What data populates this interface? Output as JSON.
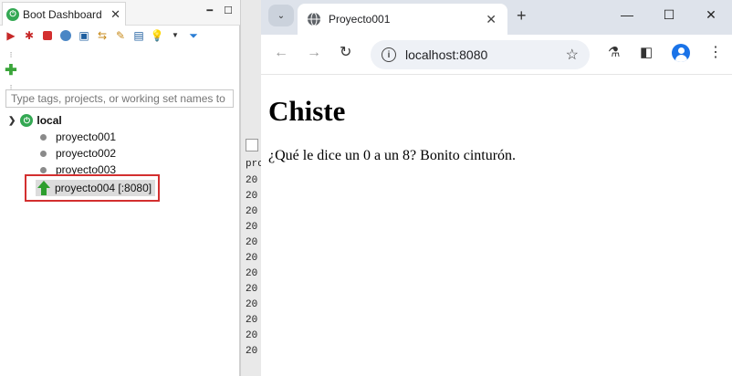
{
  "eclipse": {
    "view_title": "Boot Dashboard",
    "filter_placeholder": "Type tags, projects, or working set names to m",
    "tree": {
      "root_label": "local",
      "items": [
        {
          "label": "proyecto001"
        },
        {
          "label": "proyecto002"
        },
        {
          "label": "proyecto003"
        },
        {
          "label": "proyecto004 [:8080]"
        }
      ]
    },
    "gutter": {
      "header": "pro",
      "rows": [
        "20",
        "20",
        "20",
        "20",
        "20",
        "20",
        "20",
        "20",
        "20",
        "20",
        "20",
        "20"
      ]
    }
  },
  "browser": {
    "tab_title": "Proyecto001",
    "url": "localhost:8080",
    "page": {
      "heading": "Chiste",
      "text": "¿Qué le dice un 0 a un 8? Bonito cinturón."
    }
  },
  "colors": {
    "spring_green": "#34a853",
    "highlight_red": "#d32f2f",
    "chrome_tabstrip": "#dee3eb",
    "avatar_blue": "#1a73e8"
  }
}
